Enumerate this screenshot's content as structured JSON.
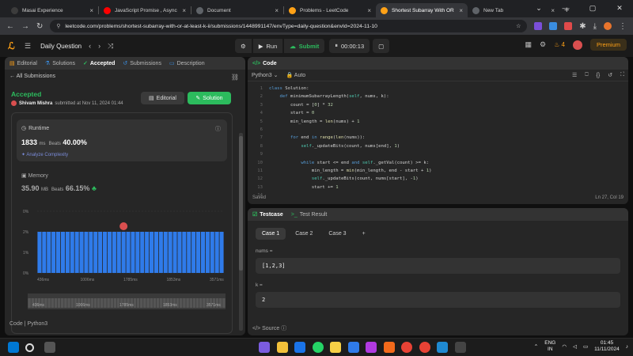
{
  "browser": {
    "tabs": [
      {
        "title": "Masai Experience",
        "color": "#3c3c3c",
        "active": false
      },
      {
        "title": "JavaScript Promise , Async",
        "color": "#ff0000",
        "active": false
      },
      {
        "title": "Document",
        "color": "#5f6368",
        "active": false
      },
      {
        "title": "Problems - LeetCode",
        "color": "#ffa116",
        "active": false
      },
      {
        "title": "Shortest Subarray With OR",
        "color": "#ffa116",
        "active": true
      },
      {
        "title": "New Tab",
        "color": "#5f6368",
        "active": false
      }
    ],
    "new_tab_label": "+",
    "url": "leetcode.com/problems/shortest-subarray-with-or-at-least-k-ii/submissions/1448991147/envType=daily-question&envId=2024-11-10"
  },
  "header": {
    "title": "Daily Question",
    "run_label": "Run",
    "submit_label": "Submit",
    "timer": "00:00:13",
    "streak": "4",
    "premium_label": "Premium"
  },
  "left": {
    "tabs": [
      "Editorial",
      "Solutions",
      "Accepted",
      "Submissions",
      "Description"
    ],
    "all_submissions": "All Submissions",
    "status": "Accepted",
    "user": "Shivam Mishra",
    "submitted_text": "submitted at Nov 11, 2024 01:44",
    "editorial_btn": "Editorial",
    "solution_btn": "Solution",
    "runtime_title": "Runtime",
    "runtime_value": "1833",
    "runtime_unit": "ms",
    "beats_label": "Beats",
    "runtime_beats": "40.00%",
    "analyze_label": "Analyze Complexity",
    "memory_title": "Memory",
    "memory_value": "35.90",
    "memory_unit": "MB",
    "memory_beats": "66.15%",
    "code_label": "Code",
    "code_lang": "Python3"
  },
  "chart_data": {
    "type": "bar",
    "y_ticks": [
      "0%",
      "2%",
      "1%",
      "0%"
    ],
    "x_ticks": [
      "436ms",
      "1006ms",
      "1785ms",
      "1853ms",
      "3571ms"
    ],
    "ylim": [
      0,
      3
    ],
    "bar_count": 40,
    "values_pct": [
      2,
      2,
      2,
      2,
      2,
      2,
      2,
      2,
      2,
      2,
      2,
      2,
      2,
      2,
      2,
      2,
      2,
      2,
      2,
      2,
      2,
      2,
      2,
      2,
      2,
      2,
      2,
      2,
      2,
      2,
      2,
      2,
      2,
      2,
      2,
      2,
      2,
      2,
      2,
      2
    ],
    "marker_position_index": 18,
    "bar_color": "#2f7bea",
    "mini_ticks": [
      "436ms",
      "1006ms",
      "1785ms",
      "1853ms",
      "3571ms"
    ]
  },
  "code": {
    "panel_title": "Code",
    "language": "Python3",
    "auto_label": "Auto",
    "line_numbers": [
      "1",
      "2",
      "3",
      "4",
      "5",
      "6",
      "7",
      "8",
      "9",
      "10",
      "11",
      "12",
      "13",
      "14"
    ],
    "lines": [
      "class Solution:",
      "    def minimumSubarrayLength(self, nums, k):",
      "        count = [0] * 32",
      "        start = 0",
      "        min_length = len(nums) + 1",
      "",
      "        for end in range(len(nums)):",
      "            self._updateBits(count, nums[end], 1)",
      "",
      "            while start <= end and self._getVal(count) >= k:",
      "                min_length = min(min_length, end - start + 1)",
      "                self._updateBits(count, nums[start], -1)",
      "                start += 1",
      ""
    ],
    "saved_label": "Saved",
    "cursor_pos": "Ln 27, Col 19"
  },
  "test": {
    "tab_label": "Testcase",
    "result_label": "Test Result",
    "cases": [
      "Case 1",
      "Case 2",
      "Case 3"
    ],
    "add_case": "+",
    "field1_label": "nums =",
    "field1_value": "[1,2,3]",
    "field2_label": "k =",
    "field2_value": "2",
    "source_label": "Source"
  },
  "taskbar": {
    "lang": "ENG",
    "region": "IN",
    "time": "01:45",
    "date": "11/11/2024"
  }
}
